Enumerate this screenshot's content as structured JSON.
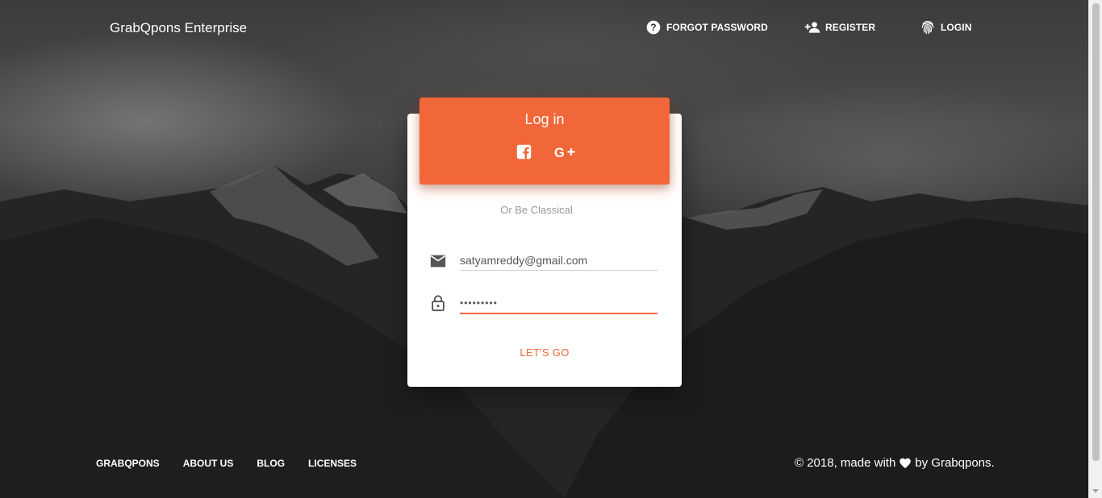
{
  "brand": {
    "name": "GrabQpons Enterprise"
  },
  "nav": {
    "forgot_password": {
      "label": "FORGOT PASSWORD",
      "icon": "help-circle-icon"
    },
    "register": {
      "label": "REGISTER",
      "icon": "person-add-icon"
    },
    "login": {
      "label": "LOGIN",
      "icon": "fingerprint-icon"
    }
  },
  "login_card": {
    "title": "Log in",
    "social": [
      {
        "name": "facebook",
        "icon": "facebook-icon"
      },
      {
        "name": "google-plus",
        "icon": "google-plus-icon"
      }
    ],
    "divider_text": "Or Be Classical",
    "email": {
      "value": "satyamreddy@gmail.com",
      "icon": "mail-icon"
    },
    "password": {
      "value": "•••••••••",
      "icon": "lock-icon"
    },
    "submit_label": "LET'S GO"
  },
  "footer": {
    "links": [
      "GRABQPONS",
      "ABOUT US",
      "BLOG",
      "LICENSES"
    ],
    "copyright_prefix": "© 2018, made with",
    "copyright_suffix": "by Grabqpons."
  },
  "colors": {
    "accent": "#f26739",
    "card_bg": "#ffffff",
    "text_light": "#ffffff"
  }
}
